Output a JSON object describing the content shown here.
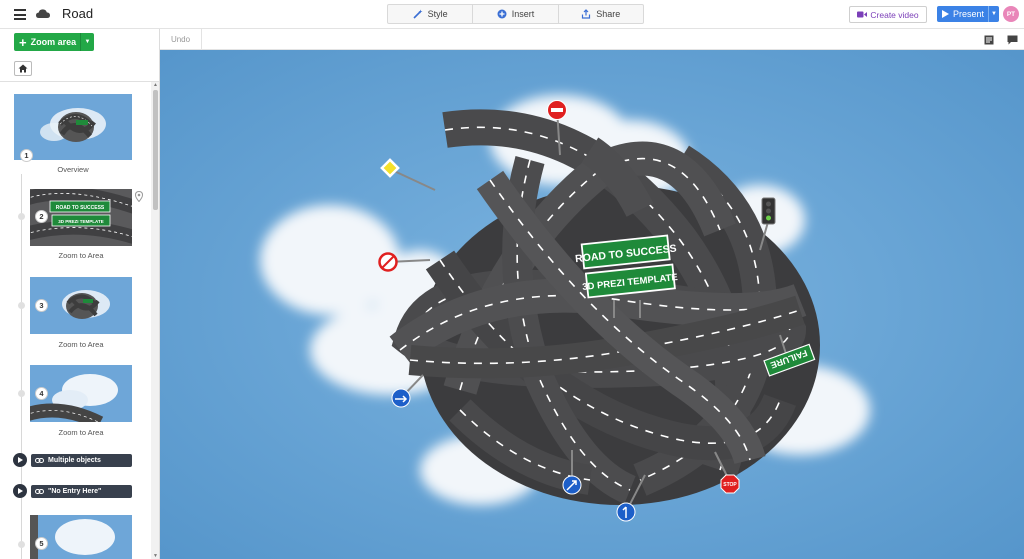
{
  "app": {
    "title": "Road",
    "menu_icon": "hamburger-icon",
    "cloud_icon": "cloud-icon"
  },
  "toolbar": {
    "style_label": "Style",
    "insert_label": "Insert",
    "share_label": "Share",
    "create_video_label": "Create video",
    "present_label": "Present",
    "avatar_initials": "PT"
  },
  "subbar": {
    "undo_label": "Undo"
  },
  "sidebar": {
    "zoom_area_label": "Zoom area",
    "items": [
      {
        "number": "1",
        "label": "Overview"
      },
      {
        "number": "2",
        "label": "Zoom to Area"
      },
      {
        "number": "3",
        "label": "Zoom to Area"
      },
      {
        "number": "4",
        "label": "Zoom to Area"
      },
      {
        "number": "5",
        "label": ""
      }
    ],
    "objects": [
      {
        "label": "Multiple objects"
      },
      {
        "label": "\"No Entry Here\""
      }
    ]
  },
  "canvas": {
    "sign_top_line": "ROAD TO SUCCESS",
    "sign_bottom_line": "3D PREZI TEMPLATE",
    "failure_sign": "FAILURE",
    "stop_sign": "STOP",
    "thumb_sign_top": "ROAD TO SUCCESS",
    "thumb_sign_bottom": "3D PREZI TEMPLATE"
  },
  "colors": {
    "sky": "#62a0d2",
    "road": "#4a4a4c",
    "sign_green": "#1f8a3a",
    "present_blue": "#3b82e6",
    "zoom_green": "#23a847",
    "video_purple": "#7b3fb8",
    "avatar_pink": "#e986b9"
  }
}
